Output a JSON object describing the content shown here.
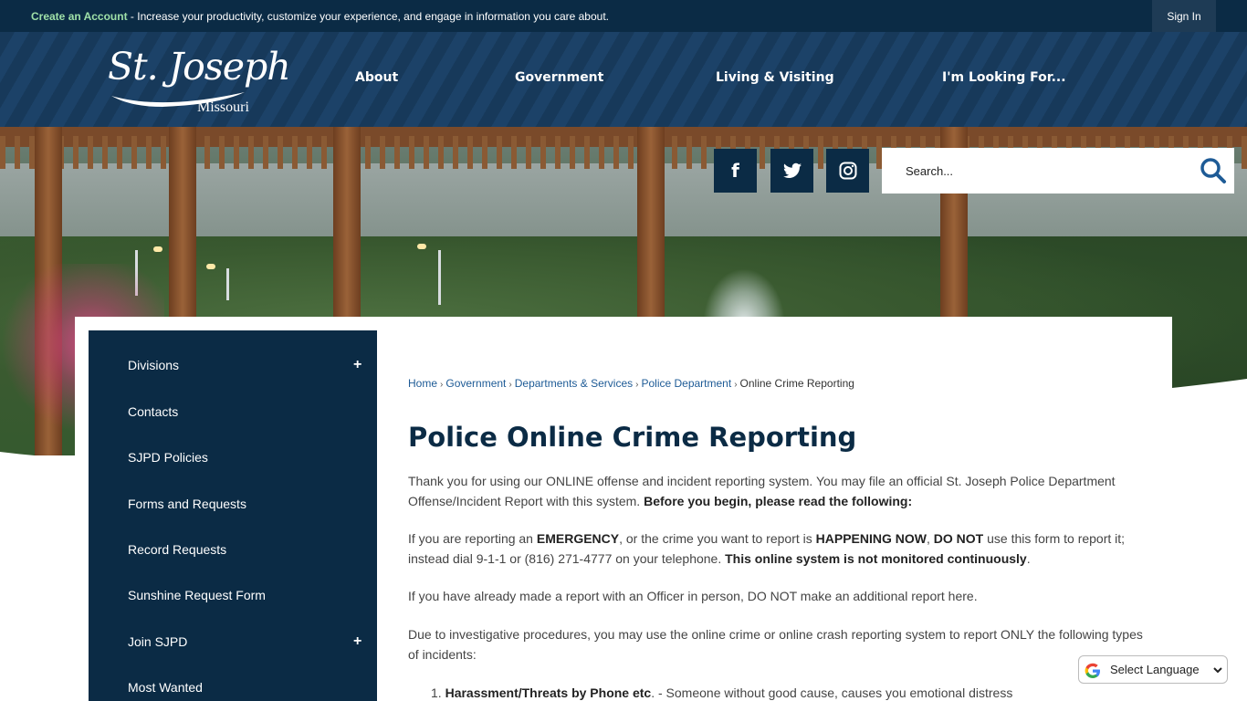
{
  "topbar": {
    "create_account": "Create an Account",
    "message": " - Increase your productivity, customize your experience, and engage in information you care about.",
    "sign_in": "Sign In"
  },
  "logo": {
    "name": "St. Joseph",
    "state": "Missouri"
  },
  "nav": {
    "about": "About",
    "government": "Government",
    "living": "Living & Visiting",
    "looking": "I'm Looking For..."
  },
  "social": {
    "facebook": "f",
    "twitter": "twitter-icon",
    "instagram": "instagram-icon"
  },
  "search": {
    "placeholder": "Search..."
  },
  "sidebar": {
    "items": [
      {
        "label": "Divisions",
        "expand": "+"
      },
      {
        "label": "Contacts"
      },
      {
        "label": "SJPD Policies"
      },
      {
        "label": "Forms and Requests"
      },
      {
        "label": "Record Requests"
      },
      {
        "label": "Sunshine Request Form"
      },
      {
        "label": "Join SJPD",
        "expand": "+"
      },
      {
        "label": "Most Wanted"
      }
    ]
  },
  "breadcrumb": {
    "home": "Home",
    "government": "Government",
    "departments": "Departments & Services",
    "police": "Police Department",
    "current": "Online Crime Reporting",
    "separator": "›"
  },
  "article": {
    "title": "Police Online Crime Reporting",
    "p1_text": "Thank you for using our ONLINE offense and incident reporting system. You may file an official St. Joseph Police Department Offense/Incident Report with this system. ",
    "p1_bold": "Before you begin, please read the following:",
    "p2_a": "If you are reporting an ",
    "p2_emergency": "EMERGENCY",
    "p2_b": ", or the crime you want to report is ",
    "p2_happening": "HAPPENING NOW",
    "p2_c": ", ",
    "p2_donot": "DO NOT",
    "p2_d": " use this form to report it; instead dial 9-1-1 or (816) 271-4777 on your telephone. ",
    "p2_bold": "This online system is not monitored continuously",
    "p2_end": ".",
    "p3": "If you have already made a report with an Officer in person, DO NOT make an additional report here.",
    "p4": "Due to investigative procedures, you may use the online crime or online crash reporting system to report ONLY the following types of incidents:",
    "list1_num": "1.",
    "list1_bold": "Harassment/Threats by Phone etc",
    "list1_text": ". - Someone without good cause, causes you emotional distress"
  },
  "language": {
    "label": "Select Language"
  },
  "colors": {
    "navy": "#0b2b45",
    "header": "#17395a",
    "link": "#1e5b96",
    "accent_green": "#9fe0a8"
  }
}
